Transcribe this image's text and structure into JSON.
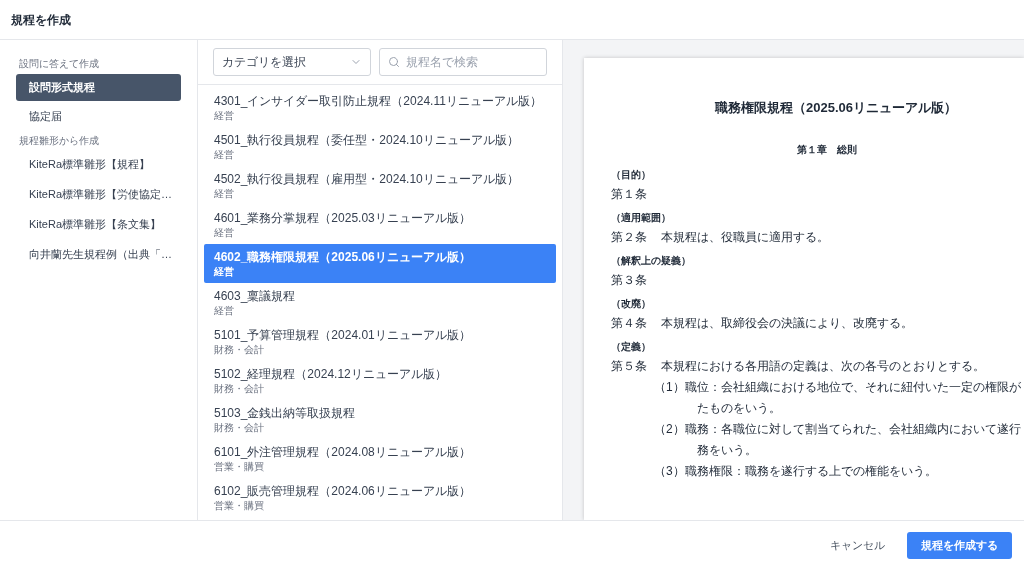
{
  "dialog": {
    "title": "規程を作成"
  },
  "sidebar": {
    "sections": [
      {
        "heading": "設問に答えて作成",
        "items": [
          {
            "label": "設問形式規程",
            "selected": true
          },
          {
            "label": "協定届",
            "selected": false
          }
        ]
      },
      {
        "heading": "規程雛形から作成",
        "items": [
          {
            "label": "KiteRa標準雛形【規程】",
            "selected": false
          },
          {
            "label": "KiteRa標準雛形【労使協定…",
            "selected": false
          },
          {
            "label": "KiteRa標準雛形【条文集】",
            "selected": false
          },
          {
            "label": "向井蘭先生規程例（出典「…",
            "selected": false
          }
        ]
      }
    ]
  },
  "filters": {
    "category": {
      "value": "カテゴリを選択"
    },
    "search": {
      "placeholder": "規程名で検索"
    }
  },
  "templates": [
    {
      "name": "4301_インサイダー取引防止規程（2024.11リニューアル版）",
      "category": "経営",
      "selected": false
    },
    {
      "name": "4501_執行役員規程（委任型・2024.10リニューアル版）",
      "category": "経営",
      "selected": false
    },
    {
      "name": "4502_執行役員規程（雇用型・2024.10リニューアル版）",
      "category": "経営",
      "selected": false
    },
    {
      "name": "4601_業務分掌規程（2025.03リニューアル版）",
      "category": "経営",
      "selected": false
    },
    {
      "name": "4602_職務権限規程（2025.06リニューアル版）",
      "category": "経営",
      "selected": true
    },
    {
      "name": "4603_稟議規程",
      "category": "経営",
      "selected": false
    },
    {
      "name": "5101_予算管理規程（2024.01リニューアル版）",
      "category": "財務・会計",
      "selected": false
    },
    {
      "name": "5102_経理規程（2024.12リニューアル版）",
      "category": "財務・会計",
      "selected": false
    },
    {
      "name": "5103_金銭出納等取扱規程",
      "category": "財務・会計",
      "selected": false
    },
    {
      "name": "6101_外注管理規程（2024.08リニューアル版）",
      "category": "営業・購買",
      "selected": false
    },
    {
      "name": "6102_販売管理規程（2024.06リニューアル版）",
      "category": "営業・購買",
      "selected": false
    }
  ],
  "preview": {
    "title": "職務権限規程（2025.06リニューアル版）",
    "chapter": "第１章　総則",
    "articles": [
      {
        "caption": "（目的）",
        "number": "第１条"
      },
      {
        "caption": "（適用範囲）",
        "number": "第２条",
        "text": "本規程は、役職員に適用する。"
      },
      {
        "caption": "（解釈上の疑義）",
        "number": "第３条"
      },
      {
        "caption": "（改廃）",
        "number": "第４条",
        "text": "本規程は、取締役会の決議により、改廃する。"
      },
      {
        "caption": "（定義）",
        "number": "第５条",
        "text": "本規程における各用語の定義は、次の各号のとおりとする。",
        "items": [
          {
            "marker": "（1）",
            "lines": [
              "職位：会社組織における地位で、それに紐付いた一定の権限が",
              "たものをいう。"
            ]
          },
          {
            "marker": "（2）",
            "lines": [
              "職務：各職位に対して割当てられた、会社組織内において遂行",
              "務をいう。"
            ]
          },
          {
            "marker": "（3）",
            "lines": [
              "職務権限：職務を遂行する上での権能をいう。"
            ]
          }
        ]
      }
    ]
  },
  "footer": {
    "buttons": [
      {
        "label": "キャンセル",
        "kind": "text"
      },
      {
        "label": "規程を作成する",
        "kind": "primary"
      }
    ]
  }
}
